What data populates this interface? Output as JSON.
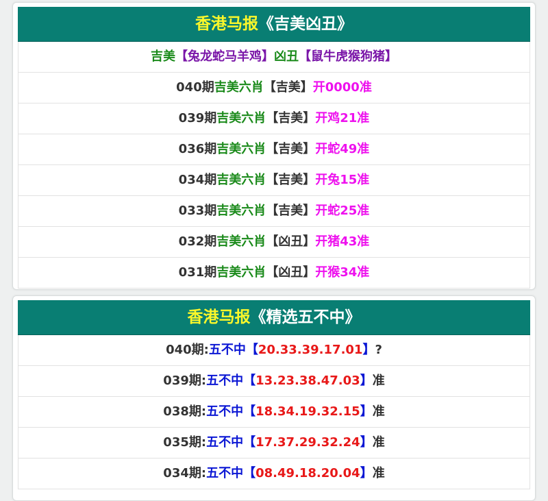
{
  "colors": {
    "header_bg": "#097e73",
    "header_highlight": "#fbf72a",
    "green": "#1a8a1a",
    "purple": "#7a16a8",
    "magenta": "#ee11ee",
    "blue": "#0a16d4",
    "red": "#e81818"
  },
  "panel1": {
    "title_highlight": "香港马报",
    "title_rest": "《吉美凶丑》",
    "legend": {
      "good_label": "吉美",
      "good_group": "【兔龙蛇马羊鸡】",
      "bad_label": "凶丑",
      "bad_group": "【鼠牛虎猴狗猪】"
    },
    "rows": [
      {
        "period": "040期",
        "category": "吉美六肖",
        "tag": "【吉美】",
        "result": "开0000准"
      },
      {
        "period": "039期",
        "category": "吉美六肖",
        "tag": "【吉美】",
        "result": "开鸡21准"
      },
      {
        "period": "036期",
        "category": "吉美六肖",
        "tag": "【吉美】",
        "result": "开蛇49准"
      },
      {
        "period": "034期",
        "category": "吉美六肖",
        "tag": "【吉美】",
        "result": "开兔15准"
      },
      {
        "period": "033期",
        "category": "吉美六肖",
        "tag": "【吉美】",
        "result": "开蛇25准"
      },
      {
        "period": "032期",
        "category": "吉美六肖",
        "tag": "【凶丑】",
        "result": "开猪43准"
      },
      {
        "period": "031期",
        "category": "吉美六肖",
        "tag": "【凶丑】",
        "result": "开猴34准"
      }
    ]
  },
  "panel2": {
    "title_highlight": "香港马报",
    "title_rest": "《精选五不中》",
    "rows": [
      {
        "period": "040期:",
        "label": "五不中",
        "open": "【",
        "numbers": "20.33.39.17.01",
        "close": "】",
        "status": "?"
      },
      {
        "period": "039期:",
        "label": "五不中",
        "open": "【",
        "numbers": "13.23.38.47.03",
        "close": "】",
        "status": "准"
      },
      {
        "period": "038期:",
        "label": "五不中",
        "open": "【",
        "numbers": "18.34.19.32.15",
        "close": "】",
        "status": "准"
      },
      {
        "period": "035期:",
        "label": "五不中",
        "open": "【",
        "numbers": "17.37.29.32.24",
        "close": "】",
        "status": "准"
      },
      {
        "period": "034期:",
        "label": "五不中",
        "open": "【",
        "numbers": "08.49.18.20.04",
        "close": "】",
        "status": "准"
      }
    ]
  }
}
